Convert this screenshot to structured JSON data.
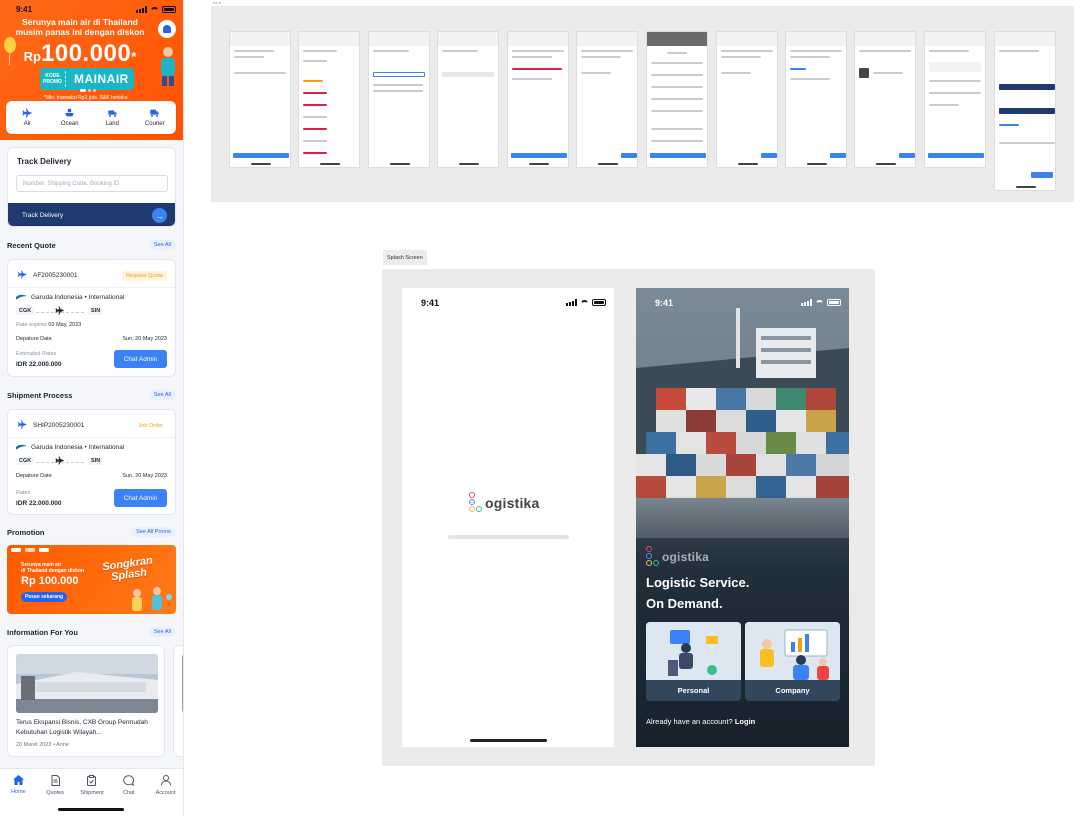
{
  "home": {
    "time": "9:41",
    "banner": {
      "line1": "Serunya main air di Thailand",
      "line2": "musim panas ini dengan diskon",
      "currency": "Rp",
      "amount": "100.000",
      "amount_suffix": "*",
      "code_label": "KODE PROMO",
      "code": "MAINAIR",
      "terms": "*Min. transaksi Rp1 juta. S&K berlaku."
    },
    "modes": [
      {
        "label": "Air",
        "icon": "plane-icon"
      },
      {
        "label": "Ocean",
        "icon": "ship-icon"
      },
      {
        "label": "Land",
        "icon": "truck-icon"
      },
      {
        "label": "Courier",
        "icon": "courier-truck-icon"
      }
    ],
    "track": {
      "title": "Track Delivery",
      "placeholder": "Number, Shipping Code, Booking ID",
      "button": "Track Delivery"
    },
    "recent_quote": {
      "title": "Recent Quote",
      "see_all": "See All",
      "id": "AF2005230001",
      "badge": "Request Quote",
      "airline": "Garuda Indonesia • International",
      "from": "CGK",
      "to": "SIN",
      "rate_expires_label": "Rate expires",
      "rate_expires_value": "02 May, 2023",
      "departure_label": "Depature Date",
      "departure_value": "Sun, 20 May 2023",
      "rates_label": "Estimated Rates",
      "rates_value": "IDR 22.000.000",
      "action": "Chat Admin"
    },
    "shipment": {
      "title": "Shipment Process",
      "see_all": "See All",
      "id": "SHIP2005230001",
      "badge": "Job Order",
      "airline": "Garuda Indonesia • International",
      "from": "CGK",
      "to": "SIN",
      "departure_label": "Depature Date",
      "departure_value": "Sun, 20 May 2023",
      "rates_label": "Rates",
      "rates_value": "IDR 22.000.000",
      "action": "Chat Admin"
    },
    "promotion": {
      "title": "Promotion",
      "see_all": "See All Promo",
      "text_line1": "Serunya main air",
      "text_line2": "di Thailand dengan diskon",
      "amount": "Rp 100.000",
      "cta": "Pesan sekarang",
      "headline1": "Songkran",
      "headline2": "Splash"
    },
    "info": {
      "title": "Information For You",
      "see_all": "See All",
      "articles": [
        {
          "title": "Terus Ekspansi Bisnis, CXB Group Permudah Kebutuhan Logistik Wilayah...",
          "meta": "20 Maret 2023 • Anne"
        }
      ]
    },
    "tabs": [
      {
        "label": "Home",
        "icon": "home-icon"
      },
      {
        "label": "Quotes",
        "icon": "document-icon"
      },
      {
        "label": "Shipment",
        "icon": "clipboard-check-icon"
      },
      {
        "label": "Chat",
        "icon": "chat-bubble-icon"
      },
      {
        "label": "Account",
        "icon": "user-icon"
      }
    ]
  },
  "splash": {
    "section_label": "Splash Screen",
    "time": "9:41",
    "brand": "ogistika",
    "headline1": "Logistic Service.",
    "headline2": "On Demand.",
    "options": [
      "Personal",
      "Company"
    ],
    "account_text": "Already have an account?",
    "login": "Login"
  },
  "colors": {
    "primary": "#3b82f6",
    "navy": "#1e3a6e",
    "orange": "#ff5a00",
    "badge_orange": "#f59e0b"
  }
}
